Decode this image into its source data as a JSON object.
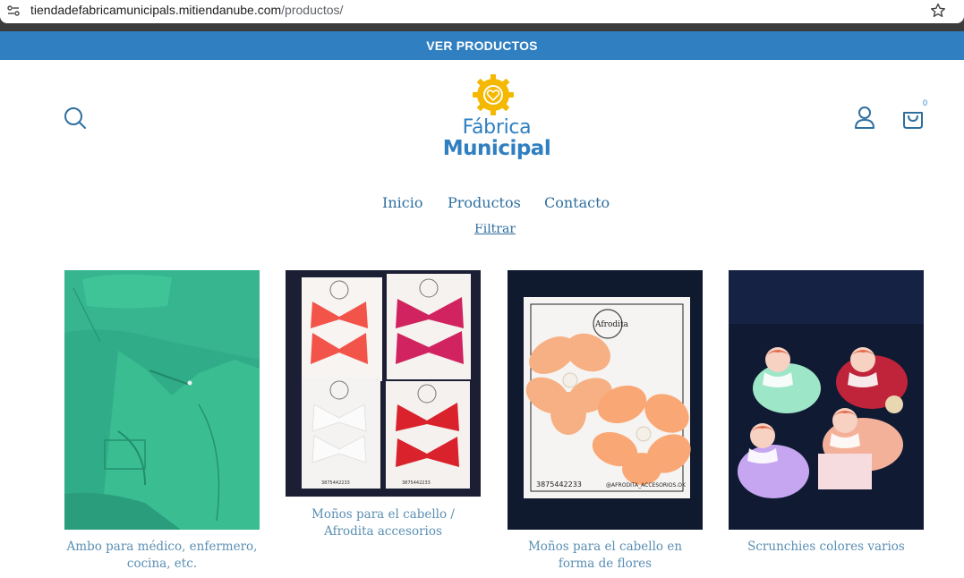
{
  "browser": {
    "url_host": "tiendadefabricamunicipals.mitiendanube.com",
    "url_path": "/productos/"
  },
  "announcement": {
    "label": "VER PRODUCTOS"
  },
  "header": {
    "logo_line1": "Fábrica",
    "logo_line2": "Municipal",
    "cart_count": "0",
    "brand_colors": {
      "primary": "#2f7fc1",
      "logo_yellow": "#f5b800"
    }
  },
  "nav": {
    "items": [
      {
        "label": "Inicio"
      },
      {
        "label": "Productos"
      },
      {
        "label": "Contacto"
      }
    ]
  },
  "filter": {
    "label": "Filtrar"
  },
  "products": [
    {
      "name": "Ambo para médico, enfermero, cocina, etc.",
      "image": "green-scrubs-photo"
    },
    {
      "name": "Moños para el cabello / Afrodita accesorios",
      "image": "hair-bows-cards-photo"
    },
    {
      "name": "Moños para el cabello en forma de flores",
      "image": "peach-flower-clips-photo"
    },
    {
      "name": "Scrunchies colores varios",
      "image": "scrunchies-photo"
    }
  ],
  "image_text": {
    "card_brand": "Afrodita",
    "card_phone": "3875442233",
    "card_handle": "@AFRODITA_ACCESORIOS.OK"
  }
}
